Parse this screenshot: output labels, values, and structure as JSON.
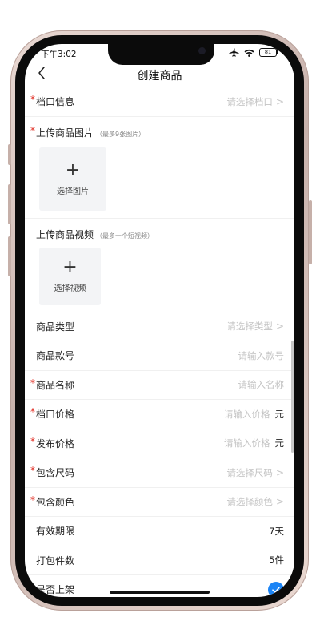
{
  "status_bar": {
    "time": "下午3:02",
    "battery": "81"
  },
  "nav": {
    "title": "创建商品"
  },
  "form": {
    "stall": {
      "label": "档口信息",
      "placeholder": "请选择档口",
      "arrow": ">"
    },
    "images": {
      "label": "上传商品图片",
      "hint": "（最多9张图片）",
      "plus": "+",
      "button": "选择图片"
    },
    "video": {
      "label": "上传商品视频",
      "hint": "（最多一个短视频）",
      "plus": "+",
      "button": "选择视频"
    },
    "type": {
      "label": "商品类型",
      "placeholder": "请选择类型",
      "arrow": ">"
    },
    "style_no": {
      "label": "商品款号",
      "placeholder": "请输入款号"
    },
    "name": {
      "label": "商品名称",
      "placeholder": "请输入名称"
    },
    "stall_price": {
      "label": "档口价格",
      "placeholder": "请输入价格",
      "unit": "元"
    },
    "publish_price": {
      "label": "发布价格",
      "placeholder": "请输入价格",
      "unit": "元"
    },
    "sizes": {
      "label": "包含尺码",
      "placeholder": "请选择尺码",
      "arrow": ">"
    },
    "colors": {
      "label": "包含颜色",
      "placeholder": "请选择颜色",
      "arrow": ">"
    },
    "validity": {
      "label": "有效期限",
      "value": "7天"
    },
    "pack_count": {
      "label": "打包件数",
      "value": "5件"
    },
    "on_shelf": {
      "label": "是否上架",
      "checked": true
    }
  },
  "required_mark": "*",
  "colors": {
    "accent": "#1b84f5",
    "required": "#e0291f"
  }
}
